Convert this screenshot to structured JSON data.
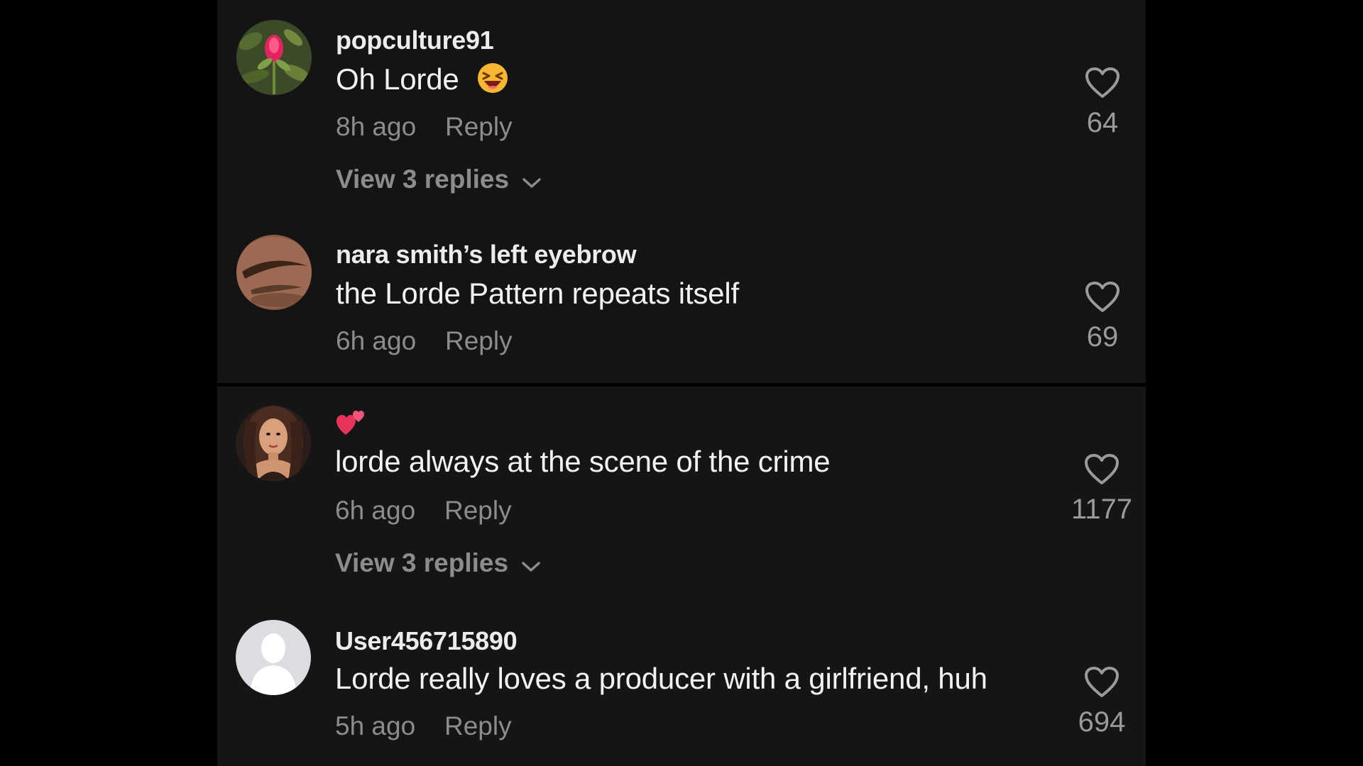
{
  "comments": [
    {
      "username": "popculture91",
      "text": "Oh Lorde",
      "emoji": "laughing-face-emoji",
      "time": "8h ago",
      "reply_label": "Reply",
      "view_replies": "View 3 replies",
      "likes": "64"
    },
    {
      "username": "nara smith’s left eyebrow",
      "text": "the Lorde Pattern repeats itself",
      "time": "6h ago",
      "reply_label": "Reply",
      "likes": "69"
    },
    {
      "username_emoji": "two-hearts-emoji",
      "text": "lorde always at the scene of the crime",
      "time": "6h ago",
      "reply_label": "Reply",
      "view_replies": "View 3 replies",
      "likes": "1177"
    },
    {
      "username": "User456715890",
      "text": "Lorde really loves a producer with a girlfriend, huh",
      "time": "5h ago",
      "reply_label": "Reply",
      "likes": "694"
    }
  ],
  "colors": {
    "background": "#000000",
    "panel": "#141414",
    "username": "#ececec",
    "text": "#f2f2f2",
    "meta": "#8c8c8c",
    "heart_emoji": "#e8345a"
  }
}
